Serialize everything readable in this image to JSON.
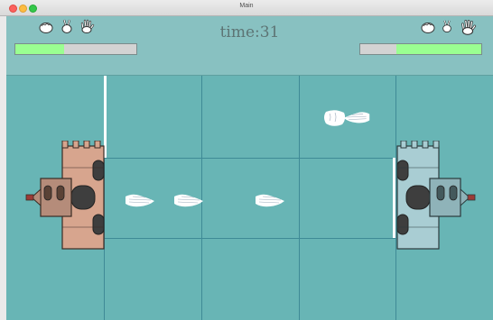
{
  "window": {
    "title": "Main"
  },
  "hud": {
    "timer_label": "time:31",
    "left_player": {
      "hands": [
        "rock-icon",
        "scissors-icon",
        "paper-icon"
      ],
      "health_fraction": 0.4
    },
    "right_player": {
      "hands": [
        "rock-icon",
        "scissors-icon",
        "paper-icon"
      ],
      "health_fraction": 0.7
    }
  },
  "colors": {
    "hud_bg": "#88c1c1",
    "field_bg": "#68b5b5",
    "grid_line": "#3f8a96",
    "health_fill": "#9aff91",
    "health_empty": "#d3d3d3",
    "left_castle": "#d7a58e",
    "right_castle": "#a9cdd3"
  },
  "field": {
    "units": [
      {
        "type": "paper-hand",
        "lane": "bottom",
        "side": "left"
      },
      {
        "type": "paper-hand",
        "lane": "bottom",
        "side": "left"
      },
      {
        "type": "paper-hand",
        "lane": "bottom",
        "side": "left"
      },
      {
        "type": "rock-hand",
        "lane": "top",
        "side": "right"
      },
      {
        "type": "paper-hand",
        "lane": "top",
        "side": "right"
      }
    ]
  }
}
